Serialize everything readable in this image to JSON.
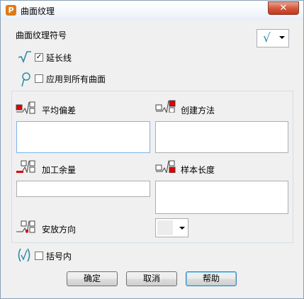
{
  "window": {
    "title": "曲面纹理",
    "app_icon": "P",
    "close_glyph": "✕"
  },
  "symbol_section": {
    "label": "曲面纹理符号",
    "combo_symbol": "√"
  },
  "extend_line": {
    "label": "延长线",
    "checked": true
  },
  "apply_all": {
    "label": "应用到所有曲面",
    "checked": false
  },
  "fields": {
    "average_deviation": {
      "label": "平均偏差",
      "value": ""
    },
    "creation_method": {
      "label": "创建方法",
      "value": ""
    },
    "machining_allowance": {
      "label": "加工余量",
      "value": ""
    },
    "sampling_length": {
      "label": "样本长度",
      "value": ""
    },
    "lay_direction": {
      "label": "安放方向",
      "value": ""
    }
  },
  "bracket": {
    "label": "括号内",
    "checked": false
  },
  "buttons": {
    "ok": "确定",
    "cancel": "取消",
    "help": "帮助"
  },
  "colors": {
    "accent_marker": "#e00000",
    "symbol_teal": "#2f8aa8"
  }
}
